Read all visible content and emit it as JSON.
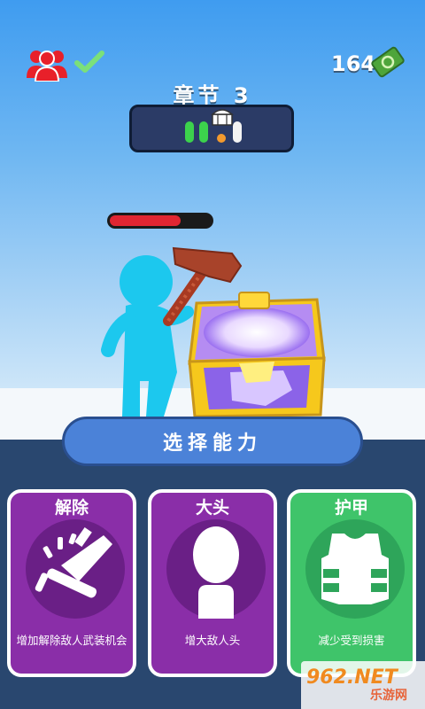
{
  "hud": {
    "money": "164",
    "players_icon": "players-icon",
    "check_icon": "checkmark-icon",
    "cash_icon": "cash-icon"
  },
  "chapter": {
    "title": "章节 3",
    "progress_icons": [
      "chest-icon"
    ]
  },
  "enemy": {
    "health_fraction": 0.7
  },
  "banner": {
    "label": "选择能力"
  },
  "cards": [
    {
      "title": "解除",
      "description": "增加解除敌人武装机会",
      "icon": "disarm-icon",
      "color": "#8a2ea8"
    },
    {
      "title": "大头",
      "description": "增大敌人头",
      "icon": "big-head-icon",
      "color": "#8a2ea8"
    },
    {
      "title": "护甲",
      "description": "减少受到损害",
      "icon": "armor-vest-icon",
      "color": "#3fc46a"
    }
  ],
  "watermark": {
    "logo": "962.NET",
    "sub": "乐游网"
  }
}
